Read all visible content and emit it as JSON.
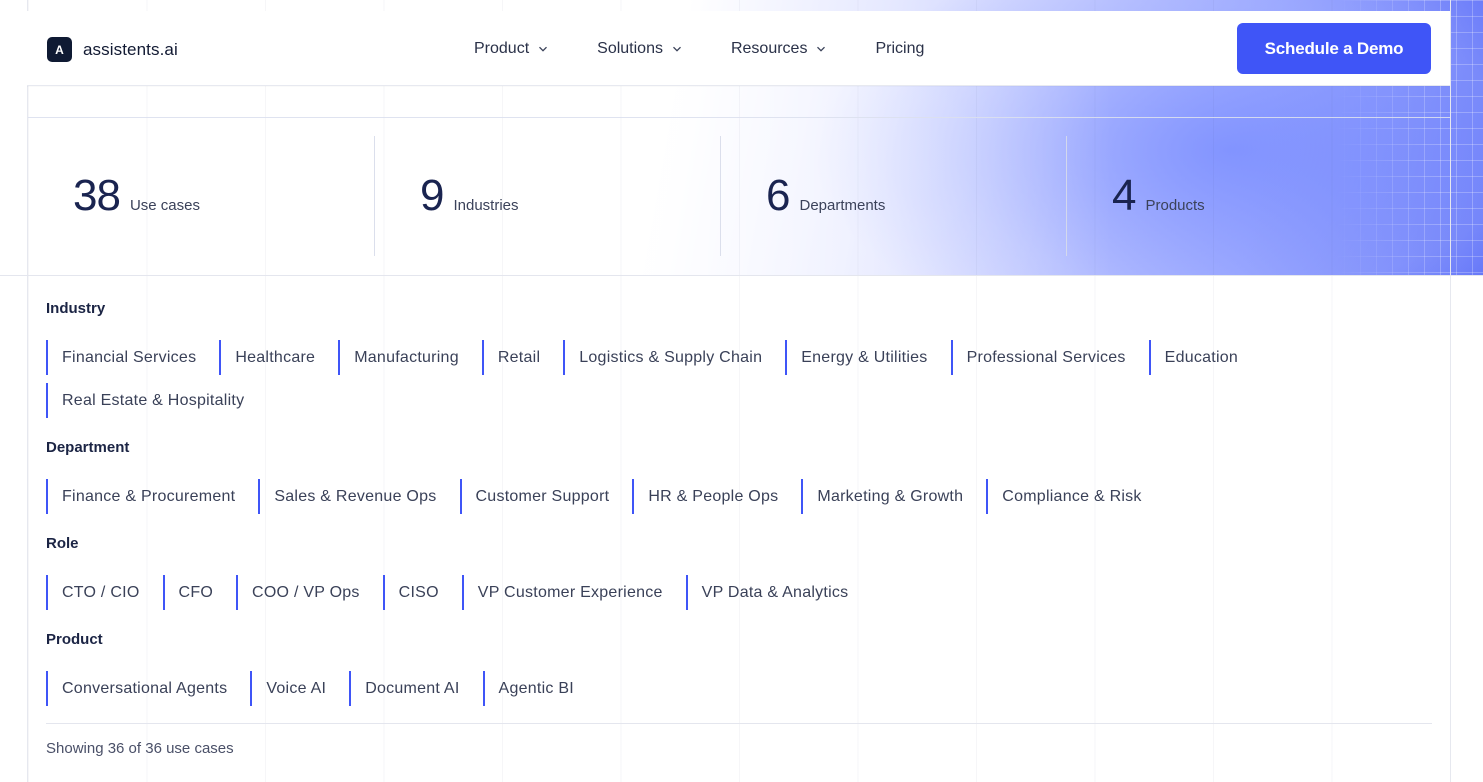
{
  "brand": {
    "logo_letter": "A",
    "name": "assistents.ai"
  },
  "nav": {
    "items": [
      {
        "label": "Product",
        "has_dropdown": true
      },
      {
        "label": "Solutions",
        "has_dropdown": true
      },
      {
        "label": "Resources",
        "has_dropdown": true
      },
      {
        "label": "Pricing",
        "has_dropdown": false
      }
    ],
    "cta_label": "Schedule a Demo"
  },
  "stats": [
    {
      "value": "38",
      "label": "Use cases"
    },
    {
      "value": "9",
      "label": "Industries"
    },
    {
      "value": "6",
      "label": "Departments"
    },
    {
      "value": "4",
      "label": "Products"
    }
  ],
  "filters": {
    "industry": {
      "title": "Industry",
      "options": [
        "Financial Services",
        "Healthcare",
        "Manufacturing",
        "Retail",
        "Logistics & Supply Chain",
        "Energy & Utilities",
        "Professional Services",
        "Education",
        "Real Estate & Hospitality"
      ]
    },
    "department": {
      "title": "Department",
      "options": [
        "Finance & Procurement",
        "Sales & Revenue Ops",
        "Customer Support",
        "HR & People Ops",
        "Marketing & Growth",
        "Compliance & Risk"
      ]
    },
    "role": {
      "title": "Role",
      "options": [
        "CTO / CIO",
        "CFO",
        "COO / VP Ops",
        "CISO",
        "VP Customer Experience",
        "VP Data & Analytics"
      ]
    },
    "product": {
      "title": "Product",
      "options": [
        "Conversational Agents",
        "Voice AI",
        "Document AI",
        "Agentic BI"
      ]
    }
  },
  "results": {
    "count_text": "Showing 36 of 36 use cases"
  },
  "colors": {
    "accent": "#3f55f7",
    "text_dark": "#1b2444"
  }
}
